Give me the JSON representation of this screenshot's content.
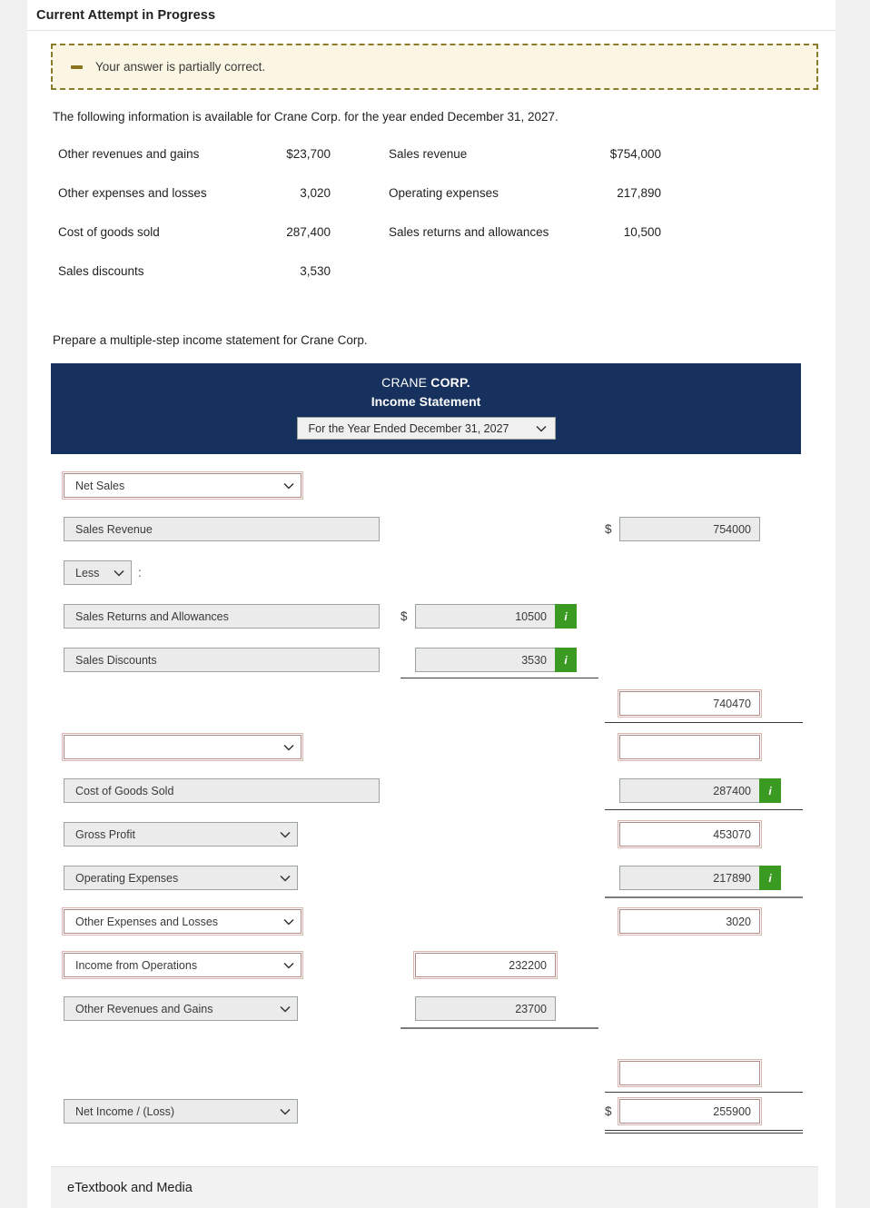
{
  "header": {
    "attempt_title": "Current Attempt in Progress"
  },
  "alert": {
    "message": "Your answer is partially correct.",
    "icon": "minus-icon"
  },
  "intro": "The following information is available for Crane Corp. for the year ended December 31, 2027.",
  "facts": [
    {
      "label": "Other revenues and gains",
      "value": "$23,700",
      "label2": "Sales revenue",
      "value2": "$754,000"
    },
    {
      "label": "Other expenses and losses",
      "value": "3,020",
      "label2": "Operating expenses",
      "value2": "217,890"
    },
    {
      "label": "Cost of goods sold",
      "value": "287,400",
      "label2": "Sales returns and allowances",
      "value2": "10,500"
    },
    {
      "label": "Sales discounts",
      "value": "3,530",
      "label2": "",
      "value2": ""
    }
  ],
  "prepare_instruction": "Prepare a multiple-step income statement for Crane Corp.",
  "statement": {
    "company": "CRANE ",
    "company_bold": "CORP.",
    "subtitle": "Income Statement",
    "period": "For the Year Ended December 31, 2027",
    "rows": [
      {
        "label": "Net Sales",
        "mid": "",
        "right": ""
      },
      {
        "label": "Sales Revenue",
        "mid": "",
        "right": "754000"
      },
      {
        "label": "Less",
        "mid": "",
        "right": ""
      },
      {
        "label": "Sales Returns and Allowances",
        "mid": "10500",
        "right": ""
      },
      {
        "label": "Sales Discounts",
        "mid": "3530",
        "right": ""
      },
      {
        "label": "",
        "mid": "",
        "right": "740470"
      },
      {
        "label": "",
        "mid": "",
        "right": ""
      },
      {
        "label": "Cost of Goods Sold",
        "mid": "",
        "right": "287400"
      },
      {
        "label": "Gross Profit",
        "mid": "",
        "right": "453070"
      },
      {
        "label": "Operating Expenses",
        "mid": "",
        "right": "217890"
      },
      {
        "label": "Other Expenses and Losses",
        "mid": "",
        "right": "3020"
      },
      {
        "label": "Income from Operations",
        "mid": "232200",
        "right": ""
      },
      {
        "label": "Other Revenues and Gains",
        "mid": "23700",
        "right": ""
      },
      {
        "label": "",
        "mid": "",
        "right": ""
      },
      {
        "label": "Net Income / (Loss)",
        "mid": "",
        "right": "255900"
      }
    ],
    "dollar_sign": "$",
    "colon": ":",
    "info_badge": "i"
  },
  "footer": {
    "etextbook": "eTextbook and Media"
  },
  "colors": {
    "navy": "#17315e",
    "alert_bg": "#fbf6e3",
    "alert_border": "#8a7c2a",
    "info_green": "#3a9a22",
    "error_border": "#b08a85",
    "field_gray": "#ebebeb"
  }
}
